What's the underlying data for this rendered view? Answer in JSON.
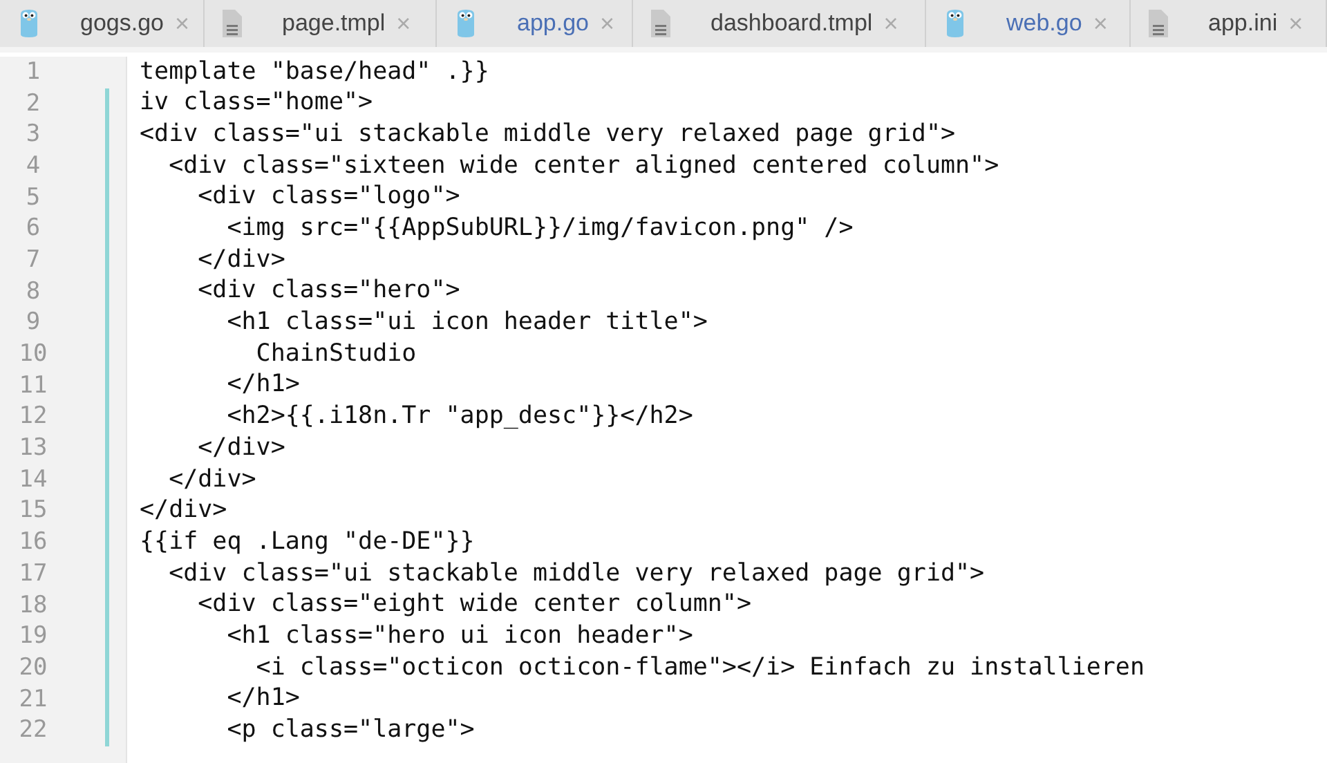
{
  "tabs": [
    {
      "label": "gogs.go",
      "kind": "go",
      "modified": false
    },
    {
      "label": "page.tmpl",
      "kind": "file",
      "modified": false
    },
    {
      "label": "app.go",
      "kind": "go",
      "modified": true
    },
    {
      "label": "dashboard.tmpl",
      "kind": "file",
      "modified": false
    },
    {
      "label": "web.go",
      "kind": "go",
      "modified": true
    },
    {
      "label": "app.ini",
      "kind": "file",
      "modified": false
    }
  ],
  "close_glyph": "×",
  "lines": [
    {
      "number": "1",
      "text": "template \"base/head\" .}}",
      "changed": false
    },
    {
      "number": "2",
      "text": "iv class=\"home\">",
      "changed": true
    },
    {
      "number": "3",
      "text": "<div class=\"ui stackable middle very relaxed page grid\">",
      "changed": true
    },
    {
      "number": "4",
      "text": "  <div class=\"sixteen wide center aligned centered column\">",
      "changed": true
    },
    {
      "number": "5",
      "text": "    <div class=\"logo\">",
      "changed": true
    },
    {
      "number": "6",
      "text": "      <img src=\"{{AppSubURL}}/img/favicon.png\" />",
      "changed": true
    },
    {
      "number": "7",
      "text": "    </div>",
      "changed": true
    },
    {
      "number": "8",
      "text": "    <div class=\"hero\">",
      "changed": true
    },
    {
      "number": "9",
      "text": "      <h1 class=\"ui icon header title\">",
      "changed": true
    },
    {
      "number": "10",
      "text": "        ChainStudio",
      "changed": true
    },
    {
      "number": "11",
      "text": "      </h1>",
      "changed": true
    },
    {
      "number": "12",
      "text": "      <h2>{{.i18n.Tr \"app_desc\"}}</h2>",
      "changed": true
    },
    {
      "number": "13",
      "text": "    </div>",
      "changed": true
    },
    {
      "number": "14",
      "text": "  </div>",
      "changed": true
    },
    {
      "number": "15",
      "text": "</div>",
      "changed": true
    },
    {
      "number": "16",
      "text": "{{if eq .Lang \"de-DE\"}}",
      "changed": true
    },
    {
      "number": "17",
      "text": "  <div class=\"ui stackable middle very relaxed page grid\">",
      "changed": true
    },
    {
      "number": "18",
      "text": "    <div class=\"eight wide center column\">",
      "changed": true
    },
    {
      "number": "19",
      "text": "      <h1 class=\"hero ui icon header\">",
      "changed": true
    },
    {
      "number": "20",
      "text": "        <i class=\"octicon octicon-flame\"></i> Einfach zu installieren",
      "changed": true
    },
    {
      "number": "21",
      "text": "      </h1>",
      "changed": true
    },
    {
      "number": "22",
      "text": "      <p class=\"large\">",
      "changed": true
    }
  ]
}
